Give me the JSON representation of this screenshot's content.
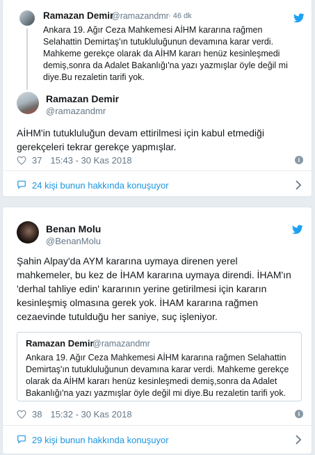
{
  "tweet1": {
    "reply_context": {
      "name": "Ramazan Demir",
      "handle": "@ramazandmr",
      "time": "· 46 dk",
      "lines": [
        "Ankara 19. Ağır Ceza Mahkemesi AİHM kararına rağmen",
        "Selahattin Demirtaş'ın tutukluluğunun devamına karar verdi.",
        "Mahkeme gerekçe olarak da AİHM kararı henüz kesinleşmedi",
        "demiş,sonra da Adalet Bakanlığı'na yazı yazmışlar öyle değil mi",
        "diye.Bu rezaletin tarifi yok."
      ]
    },
    "author": {
      "name": "Ramazan Demir",
      "handle": "@ramazandmr"
    },
    "lines": [
      "AİHM'in tutukluluğun devam ettirilmesi için kabul etmediği",
      "gerekçeleri tekrar gerekçe yapmışlar."
    ],
    "likes": "37",
    "timestamp": "15:43 - 30 Kas 2018",
    "footer": "24 kişi bunun hakkında konuşuyor",
    "icons": {
      "bird": "twitter-bird-icon",
      "heart": "heart-icon",
      "info": "info-icon",
      "comment": "comment-icon",
      "chevron": "chevron-right-icon"
    }
  },
  "tweet2": {
    "author": {
      "name": "Benan Molu",
      "handle": "@BenanMolu"
    },
    "lines": [
      "Şahin Alpay'da AYM kararına uymaya direnen yerel",
      "mahkemeler, bu kez de İHAM kararına uymaya direndi. İHAM'ın",
      "'derhal tahliye edin' kararının yerine getirilmesi için kararın",
      "kesinleşmiş olmasına gerek yok. İHAM kararına rağmen",
      "cezaevinde tutulduğu her saniye, suç işleniyor."
    ],
    "quoted": {
      "name": "Ramazan Demir",
      "handle": "@ramazandmr",
      "lines": [
        "Ankara 19. Ağır Ceza Mahkemesi AİHM kararına rağmen Selahattin",
        "Demirtaş'ın tutukluluğunun devamına karar verdi. Mahkeme gerekçe",
        "olarak da AİHM kararı henüz kesinleşmedi demiş,sonra da Adalet",
        "Bakanlığı'na yazı yazmışlar öyle değil mi diye.Bu rezaletin tarifi yok."
      ]
    },
    "likes": "38",
    "timestamp": "15:32 - 30 Kas 2018",
    "footer": "29 kişi bunun hakkında konuşuyor"
  },
  "colors": {
    "accent": "#1da1f2",
    "link": "#1b95e0",
    "muted": "#657786",
    "background": "#e6ecf0"
  }
}
